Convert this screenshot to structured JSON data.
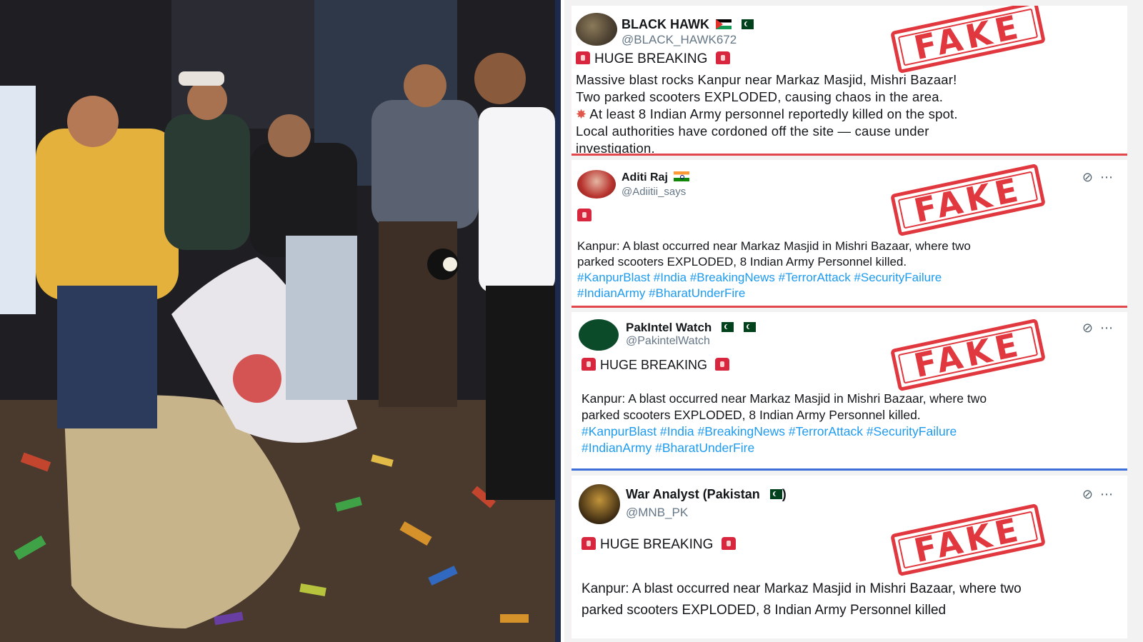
{
  "photo": {
    "description_icon": "crowd-inspecting-debris-photo"
  },
  "tweets": [
    {
      "name": "BLACK HAWK",
      "handle": "@BLACK_HAWK672",
      "headline": "HUGE BREAKING",
      "lines": [
        "Massive blast rocks Kanpur near Markaz Masjid, Mishri Bazaar!",
        "Two parked scooters EXPLODED, causing chaos in the area.",
        "At least 8 Indian Army personnel reportedly killed on the spot.",
        "Local authorities have cordoned off the site — cause under",
        "investigation."
      ],
      "stamp": "FAKE"
    },
    {
      "name": "Aditi Raj",
      "handle": "@Adiitii_says",
      "body": "Kanpur: A blast occurred near Markaz Masjid in Mishri Bazaar, where two",
      "body2": "parked scooters EXPLODED, 8 Indian Army Personnel killed.",
      "hashtags1": "#KanpurBlast #India #BreakingNews #TerrorAttack #SecurityFailure",
      "hashtags2": "#IndianArmy #BharatUnderFire",
      "stamp": "FAKE"
    },
    {
      "name": "PakIntel Watch",
      "handle": "@PakintelWatch",
      "headline": "HUGE BREAKING",
      "body": "Kanpur: A blast occurred near Markaz Masjid in Mishri Bazaar, where two",
      "body2": "parked scooters EXPLODED, 8 Indian Army Personnel killed.",
      "hashtags1": "#KanpurBlast #India #BreakingNews #TerrorAttack #SecurityFailure",
      "hashtags2": "#IndianArmy #BharatUnderFire",
      "stamp": "FAKE"
    },
    {
      "name": "War Analyst (Pakistan",
      "name_suffix": ")",
      "handle": "@MNB_PK",
      "headline": "HUGE BREAKING",
      "body": "Kanpur: A blast occurred near Markaz Masjid in Mishri Bazaar, where two",
      "body2": "parked scooters EXPLODED, 8 Indian Army Personnel killed",
      "stamp": "FAKE"
    }
  ],
  "icons": {
    "grok": "grok-icon",
    "more": "more-icon"
  },
  "colors": {
    "stamp": "#e0383e",
    "hashtag": "#1d9bf0",
    "red_rule": "#e2474b",
    "blue_rule": "#3d6fd8"
  }
}
